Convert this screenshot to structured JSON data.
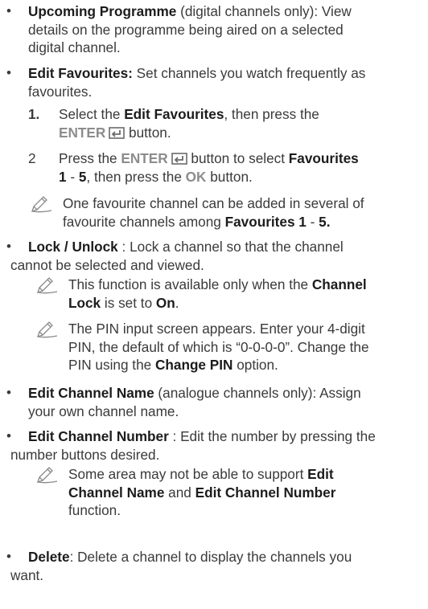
{
  "bullet_char": "•",
  "items": {
    "upcoming": {
      "title": "Upcoming Programme",
      "text1": " (digital channels only): View",
      "text2": "details on the programme being aired on a selected",
      "text3": "digital channel."
    },
    "edit_fav": {
      "title": "Edit Favourites:",
      "text1": " Set channels you watch frequently as",
      "text2": "favourites.",
      "step1": {
        "num": "1.",
        "a": "Select the ",
        "b": "Edit Favourites",
        "c": ", then press the",
        "enter": "ENTER",
        "d": " button."
      },
      "step2": {
        "num": "2",
        "a": "Press the ",
        "enter": "ENTER",
        "b": " button to select ",
        "c": "Favourites",
        "d": "1",
        "e": " - ",
        "f": "5",
        "g": ", then press the ",
        "ok": "OK",
        "h": " button."
      },
      "note": {
        "a": "One favourite channel can be added in several of",
        "b": "favourite channels among ",
        "c": "Favourites 1",
        "d": " - ",
        "e": "5."
      }
    },
    "lock": {
      "title": "Lock / Unlock",
      "text1": " : Lock a channel so that the channel",
      "text2": "cannot be selected and viewed.",
      "note1": {
        "a": "This function is available only when the ",
        "b": "Channel",
        "c": "Lock",
        "d": " is set to ",
        "e": "On",
        "f": "."
      },
      "note2": {
        "a": "The PIN input screen appears. Enter your 4-digit",
        "b": "PIN, the default of which is “0-0-0-0”. Change the",
        "c": "PIN using the ",
        "d": "Change PIN",
        "e": " option."
      }
    },
    "edit_name": {
      "title": "Edit Channel Name",
      "text1": " (analogue channels only): Assign",
      "text2": "your own channel name."
    },
    "edit_number": {
      "title": "Edit Channel Number",
      "text1": " : Edit the number by pressing the",
      "text2": "number buttons desired.",
      "note": {
        "a": "Some area may not be able to support ",
        "b": "Edit",
        "c": "Channel Name",
        "d": " and ",
        "e": "Edit Channel Number",
        "f": "function."
      }
    },
    "delete": {
      "title": "Delete",
      "text1": ": Delete a channel to display the channels you",
      "text2": "want."
    }
  },
  "icons": {
    "note": "note-pencil-icon",
    "enter": "enter-return-icon"
  }
}
